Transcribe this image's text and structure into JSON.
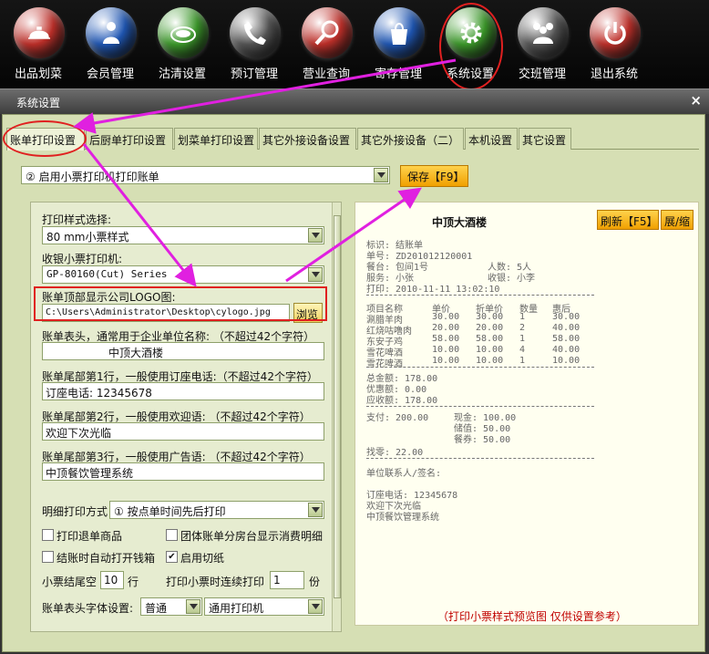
{
  "toolbar": {
    "items": [
      {
        "label": "出品划菜",
        "icon": "cloche-icon",
        "color": "#c0302a"
      },
      {
        "label": "会员管理",
        "icon": "person-icon",
        "color": "#1f57b5"
      },
      {
        "label": "沽清设置",
        "icon": "plate-icon",
        "color": "#3c9a2a"
      },
      {
        "label": "预订管理",
        "icon": "phone-icon",
        "color": "#555555"
      },
      {
        "label": "营业查询",
        "icon": "magnifier-icon",
        "color": "#c0302a"
      },
      {
        "label": "寄存管理",
        "icon": "bag-icon",
        "color": "#1f57b5"
      },
      {
        "label": "系统设置",
        "icon": "gear-icon",
        "color": "#3c9a2a"
      },
      {
        "label": "交班管理",
        "icon": "people-icon",
        "color": "#555555"
      },
      {
        "label": "退出系统",
        "icon": "power-icon",
        "color": "#c0302a"
      }
    ]
  },
  "window": {
    "title": "系统设置",
    "close": "×"
  },
  "tabs": [
    "账单打印设置",
    "后厨单打印设置",
    "划菜单打印设置",
    "其它外接设备设置",
    "其它外接设备（二）",
    "本机设置",
    "其它设置"
  ],
  "print_mode": {
    "value": "② 启用小票打印机打印账单"
  },
  "save_label": "保存【F9】",
  "form": {
    "style_label": "打印样式选择:",
    "style_value": "80 mm小票样式",
    "printer_label": "收银小票打印机:",
    "printer_value": "GP-80160(Cut) Series",
    "logo_label": "账单顶部显示公司LOGO图:",
    "logo_value": "C:\\Users\\Administrator\\Desktop\\cylogo.jpg",
    "browse_label": "浏览",
    "header_label": "账单表头，通常用于企业单位名称: （不超过42个字符）",
    "header_value": "中顶大酒楼",
    "footer1_label": "账单尾部第1行，一般使用订座电话:（不超过42个字符）",
    "footer1_value": "订座电话: 12345678",
    "footer2_label": "账单尾部第2行，一般使用欢迎语:  （不超过42个字符）",
    "footer2_value": "欢迎下次光临",
    "footer3_label": "账单尾部第3行，一般使用广告语:  （不超过42个字符）",
    "footer3_value": "中顶餐饮管理系统",
    "detail_label": "明细打印方式",
    "detail_value": "① 按点单时间先后打印",
    "cb_return": "打印退单商品",
    "cb_group": "团体账单分房台显示消费明细",
    "cb_drawer": "结账时自动打开钱箱",
    "cb_cut": "启用切纸",
    "cb_return_checked": false,
    "cb_group_checked": false,
    "cb_drawer_checked": false,
    "cb_cut_checked": true,
    "blank_label": "小票结尾空",
    "blank_value": "10",
    "blank_unit": "行",
    "copies_label": "打印小票时连续打印",
    "copies_value": "1",
    "copies_unit": "份",
    "font_label": "账单表头字体设置:",
    "font_value": "普通",
    "font_printer": "通用打印机"
  },
  "preview": {
    "refresh_label": "刷新【F5】",
    "expand_label": "展/缩",
    "title": "中顶大酒楼",
    "l1": "标识: 结账单",
    "l2": "单号: ZD201012120001",
    "l3a": "餐台: 包间1号",
    "l3b": "人数: 5人",
    "l4a": "服务: 小张",
    "l4b": "收银: 小李",
    "l5": "打印: 2010-11-11 13:02:10",
    "cols": [
      "项目名称",
      "单价",
      "折单价",
      "数量",
      "惠后"
    ],
    "rows": [
      [
        "涮腊羊肉",
        "30.00",
        "30.00",
        "1",
        "30.00"
      ],
      [
        "红烧咕噜肉",
        "20.00",
        "20.00",
        "2",
        "40.00"
      ],
      [
        "东安子鸡",
        "58.00",
        "58.00",
        "1",
        "58.00"
      ],
      [
        "雪花啤酒",
        "10.00",
        "10.00",
        "4",
        "40.00"
      ],
      [
        "雪花啤酒",
        "10.00",
        "10.00",
        "1",
        "10.00"
      ]
    ],
    "t1": "总金额: 178.00",
    "t2": "优惠额: 0.00",
    "t3": "应收额: 178.00",
    "p1a": "支付: 200.00",
    "p1b": "现金: 100.00",
    "p2": "储值: 50.00",
    "p3": "餐券: 50.00",
    "p4": "找零: 22.00",
    "sign": "单位联系人/签名:",
    "f1": "订座电话: 12345678",
    "f2": "欢迎下次光临",
    "f3": "中顶餐饮管理系统",
    "note": "（打印小票样式预览图 仅供设置参考）"
  }
}
